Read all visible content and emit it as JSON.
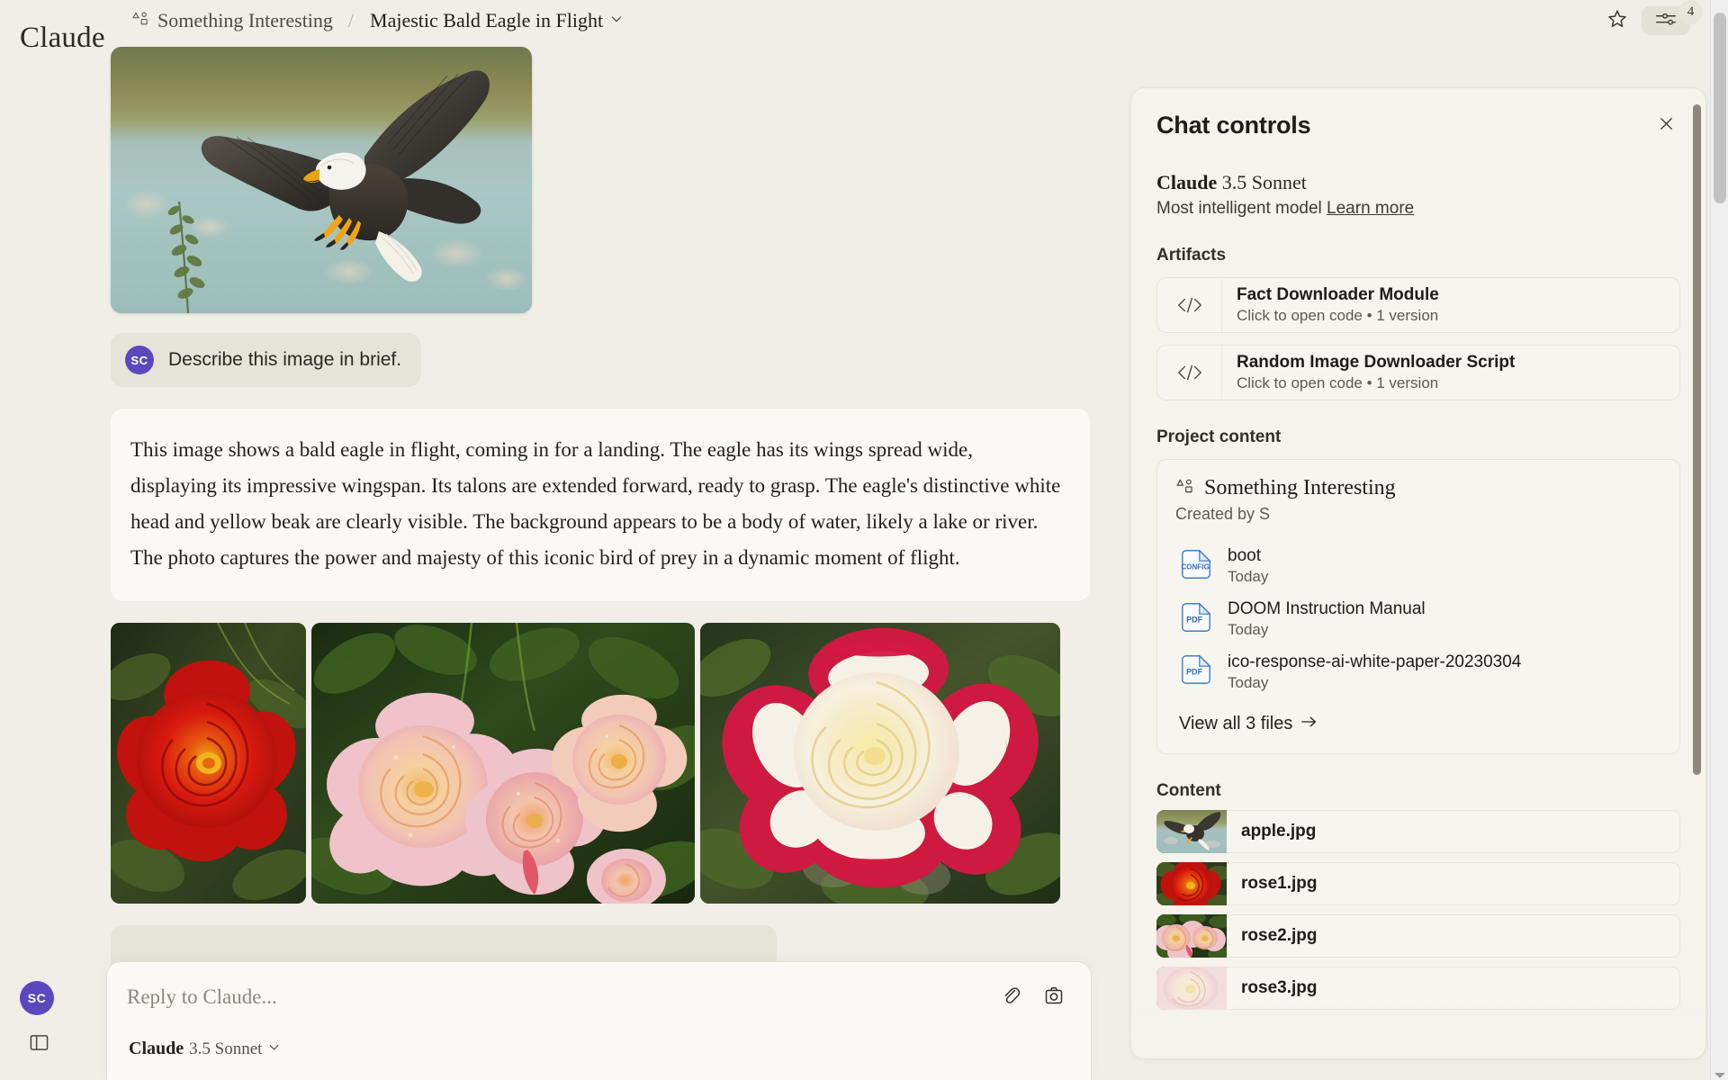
{
  "brand": "Claude",
  "breadcrumb": {
    "project_icon": "project-shapes-icon",
    "project": "Something Interesting",
    "separator": "/",
    "title": "Majestic Bald Eagle in Flight",
    "chevron": "chevron-down-icon"
  },
  "topbar": {
    "star_icon": "star-icon",
    "controls_icon": "sliders-icon",
    "controls_badge": "4"
  },
  "conversation": {
    "attached_image_alt": "bald-eagle-in-flight",
    "user": {
      "avatar_initials": "SC",
      "message": "Describe this image in brief."
    },
    "assistant": {
      "message": "This image shows a bald eagle in flight, coming in for a landing. The eagle has its wings spread wide, displaying its impressive wingspan. Its talons are extended forward, ready to grasp. The eagle's distinctive white head and yellow beak are clearly visible. The background appears to be a body of water, likely a lake or river. The photo captures the power and majesty of this iconic bird of prey in a dynamic moment of flight."
    },
    "gallery": [
      {
        "name": "rose1.jpg"
      },
      {
        "name": "rose2.jpg"
      },
      {
        "name": "rose3.jpg"
      }
    ]
  },
  "composer": {
    "placeholder": "Reply to Claude...",
    "attach_icon": "paperclip-icon",
    "screenshot_icon": "camera-icon",
    "model_name": "Claude",
    "model_version": "3.5 Sonnet",
    "model_chevron": "chevron-down-icon"
  },
  "left_rail": {
    "avatar_initials": "SC",
    "sidebar_toggle_icon": "sidebar-panel-icon"
  },
  "chat_controls": {
    "title": "Chat controls",
    "close_icon": "close-icon",
    "model": {
      "name": "Claude",
      "version": "3.5 Sonnet",
      "description": "Most intelligent model",
      "learn_more": "Learn more"
    },
    "artifacts_heading": "Artifacts",
    "artifacts": [
      {
        "icon": "code-brackets-icon",
        "title": "Fact Downloader Module",
        "subtitle": "Click to open code • 1 version"
      },
      {
        "icon": "code-brackets-icon",
        "title": "Random Image Downloader Script",
        "subtitle": "Click to open code • 1 version"
      }
    ],
    "project_heading": "Project content",
    "project": {
      "icon": "project-shapes-icon",
      "name": "Something Interesting",
      "created_by": "Created by S",
      "files": [
        {
          "type": "CONFIG",
          "name": "boot",
          "date": "Today"
        },
        {
          "type": "PDF",
          "name": "DOOM Instruction Manual",
          "date": "Today"
        },
        {
          "type": "PDF",
          "name": "ico-response-ai-white-paper-20230304",
          "date": "Today"
        }
      ],
      "view_all": "View all 3 files",
      "view_all_icon": "arrow-right-icon"
    },
    "content_heading": "Content",
    "content": [
      {
        "name": "apple.jpg",
        "thumb": "eagle"
      },
      {
        "name": "rose1.jpg",
        "thumb": "rose-red"
      },
      {
        "name": "rose2.jpg",
        "thumb": "rose-pink"
      },
      {
        "name": "rose3.jpg",
        "thumb": "rose-pale"
      }
    ]
  },
  "colors": {
    "page_bg": "#F0EEE7",
    "panel_bg": "#F5F3EC",
    "card_bg": "#FAF9F5",
    "user_bubble": "#E6E3D8",
    "avatar": "#5B48BF",
    "file_icon_blue": "#2F6FC4",
    "scrollbar_thumb": "#8C897C"
  }
}
